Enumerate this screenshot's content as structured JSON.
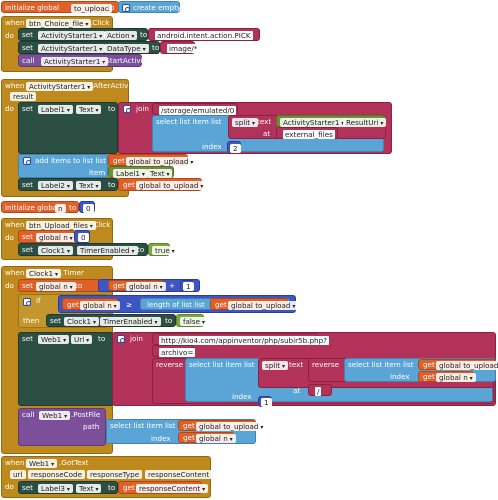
{
  "blocks": {
    "init_upload": {
      "init": "initialize global",
      "var": "to_upload",
      "to": "to",
      "create": "create empty list"
    },
    "choice_click": {
      "when": "when",
      "component": "btn_Choice_file",
      "event": ".Click",
      "do": "do",
      "set1": {
        "set": "set",
        "comp": "ActivityStarter1",
        "dot": ".",
        "prop": "Action",
        "to": "to",
        "value": "android.intent.action.PICK"
      },
      "set2": {
        "set": "set",
        "comp": "ActivityStarter1",
        "dot": ".",
        "prop": "DataType",
        "to": "to",
        "value": "image/*"
      },
      "call": {
        "call": "call",
        "comp": "ActivityStarter1",
        "method": ".StartActivity"
      }
    },
    "after_activity": {
      "when": "when",
      "component": "ActivityStarter1",
      "event": ".AfterActivity",
      "param": "result",
      "do": "do",
      "set_label": {
        "set": "set",
        "comp": "Label1",
        "dot": ".",
        "prop": "Text",
        "to": "to",
        "join": "join",
        "path": "/storage/emulated/0",
        "select": "select list item  list",
        "split": "split",
        "text": "text",
        "comp2": "ActivityStarter1",
        "prop2": "ResultUri",
        "at": "at",
        "sep": "external_files",
        "index": "index",
        "index_val": "2"
      },
      "add_items": {
        "label": "add items to list  list",
        "get": "get",
        "var": "global to_upload",
        "item": "item",
        "comp": "Label1",
        "prop": "Text"
      },
      "set_label2": {
        "set": "set",
        "comp": "Label2",
        "dot": ".",
        "prop": "Text",
        "to": "to",
        "get": "get",
        "var": "global to_upload"
      }
    },
    "init_n": {
      "init": "initialize global",
      "var": "n",
      "to": "to",
      "value": "0"
    },
    "upload_click": {
      "when": "when",
      "component": "btn_Upload_files",
      "event": ".Click",
      "do": "do",
      "set1": {
        "set": "set",
        "var": "global n",
        "to": "to",
        "value": "0"
      },
      "set2": {
        "set": "set",
        "comp": "Clock1",
        "dot": ".",
        "prop": "TimerEnabled",
        "to": "to",
        "value": "true"
      }
    },
    "timer": {
      "when": "when",
      "component": "Clock1",
      "event": ".Timer",
      "do": "do",
      "set_n": {
        "set": "set",
        "var": "global n",
        "to": "to",
        "get": "get",
        "var2": "global n",
        "op": "+",
        "value": "1"
      },
      "if": {
        "if": "if",
        "get": "get",
        "var": "global n",
        "op": "≥",
        "length": "length of list  list",
        "get2": "get",
        "var2": "global to_upload",
        "then": "then",
        "set": "set",
        "comp": "Clock1",
        "dot": ".",
        "prop": "TimerEnabled",
        "to": "to",
        "value": "false"
      },
      "set_url": {
        "set": "set",
        "comp": "Web1",
        "dot": ".",
        "prop": "Url",
        "to": "to",
        "join": "join",
        "url": "http://kio4.com/appinventor/php/subir5b.php?",
        "param": "archivo=",
        "reverse1": "reverse",
        "select1": "select list item  list",
        "split": "split",
        "text": "text",
        "reverse2": "reverse",
        "select2": "select list item  list",
        "get": "get",
        "var": "global to_upload",
        "index1": "index",
        "get2": "get",
        "var2": "global n",
        "at": "at",
        "sep": "/",
        "index2": "index",
        "index2_val": "1"
      },
      "postfile": {
        "call": "call",
        "comp": "Web1",
        "method": ".PostFile",
        "path": "path",
        "select": "select list item  list",
        "get": "get",
        "var": "global to_upload",
        "index": "index",
        "get2": "get",
        "var2": "global n"
      }
    },
    "gottext": {
      "when": "when",
      "component": "Web1",
      "event": ".GotText",
      "params": [
        "url",
        "responseCode",
        "responseType",
        "responseContent"
      ],
      "do": "do",
      "set": {
        "set": "set",
        "comp": "Label3",
        "dot": ".",
        "prop": "Text",
        "to": "to",
        "get": "get",
        "var": "responseContent"
      }
    }
  }
}
